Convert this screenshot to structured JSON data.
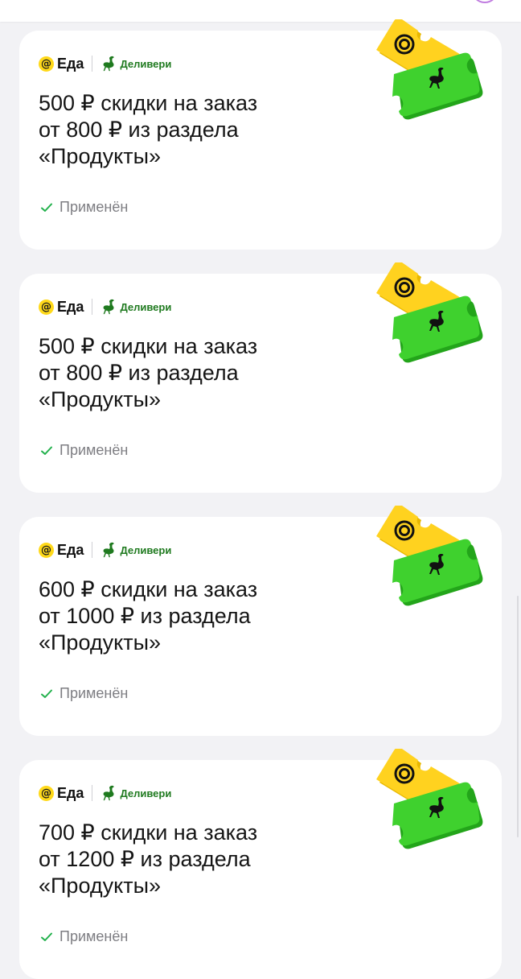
{
  "brands": {
    "eda_label": "Еда",
    "delivery_label": "Деливери",
    "eda_color": "#ffd91a",
    "delivery_color": "#1f7a1f"
  },
  "ticket": {
    "yellow_color": "#ffd21f",
    "green_color": "#3fd12e",
    "yellow_icon": "spiral-icon",
    "green_icon": "ostrich-icon"
  },
  "offers": [
    {
      "title_lines": [
        "500 ₽ скидки на заказ",
        "от 800 ₽ из раздела",
        "«Продукты»"
      ],
      "status": "Применён"
    },
    {
      "title_lines": [
        "500 ₽ скидки на заказ",
        "от 800 ₽ из раздела",
        "«Продукты»"
      ],
      "status": "Применён"
    },
    {
      "title_lines": [
        "600 ₽ скидки на заказ",
        "от 1000 ₽ из раздела",
        "«Продукты»"
      ],
      "status": "Применён"
    },
    {
      "title_lines": [
        "700 ₽ скидки на заказ",
        "от 1200 ₽ из раздела",
        "«Продукты»"
      ],
      "status": "Применён"
    }
  ]
}
